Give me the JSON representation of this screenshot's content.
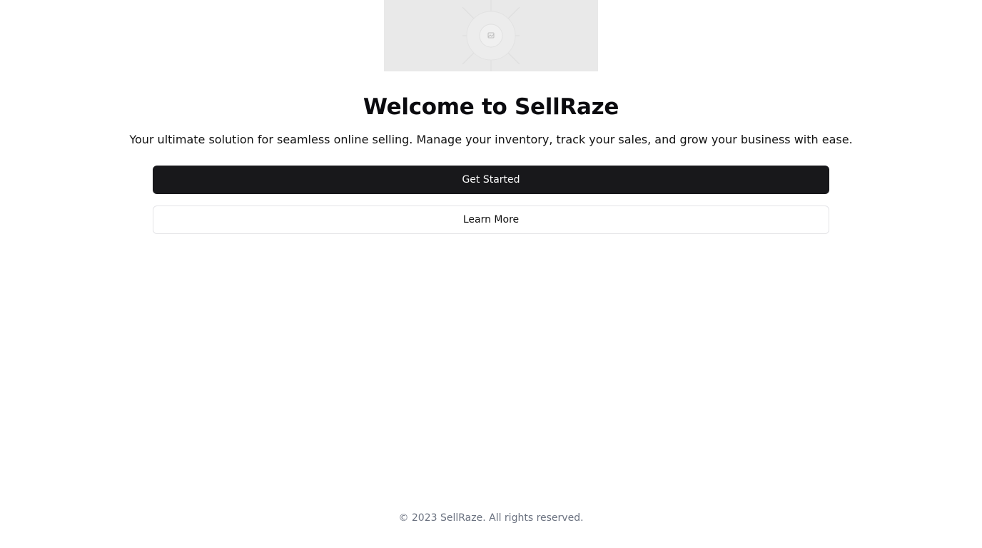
{
  "hero": {
    "image_icon": "image-placeholder-icon"
  },
  "main": {
    "title": "Welcome to SellRaze",
    "subtitle": "Your ultimate solution for seamless online selling. Manage your inventory, track your sales, and grow your business with ease.",
    "primary_button_label": "Get Started",
    "secondary_button_label": "Learn More"
  },
  "footer": {
    "copyright": "© 2023 SellRaze. All rights reserved."
  },
  "colors": {
    "primary_button_bg": "#18181b",
    "primary_button_text": "#fafafa",
    "placeholder_bg": "#e9e9e9",
    "footer_text": "#6b7280"
  }
}
